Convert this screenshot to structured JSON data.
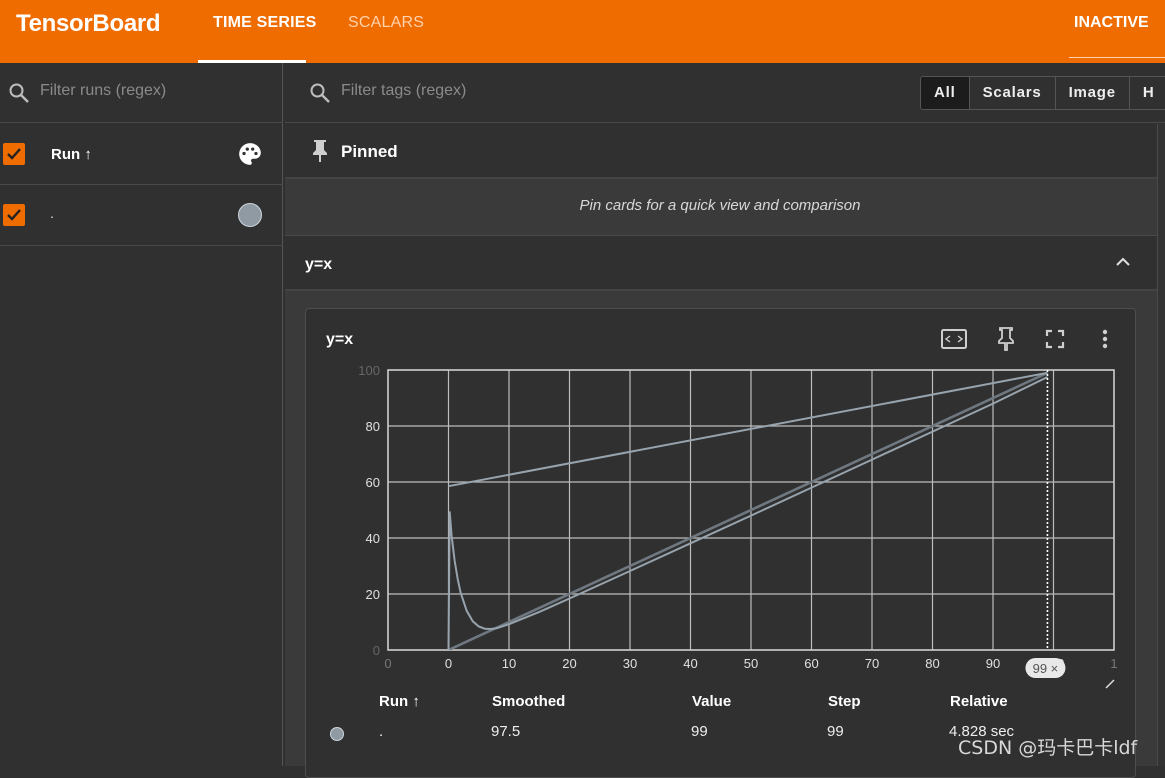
{
  "app": {
    "title": "TensorBoard"
  },
  "nav": {
    "tabs": [
      {
        "label": "TIME SERIES",
        "active": true
      },
      {
        "label": "SCALARS",
        "active": false
      }
    ],
    "reload_status": "INACTIVE"
  },
  "sidebar": {
    "filter_placeholder": "Filter runs (regex)",
    "header": {
      "label": "Run ↑",
      "checked": true
    },
    "runs": [
      {
        "name": ".",
        "checked": true,
        "color": "#8f9aa3"
      }
    ]
  },
  "main": {
    "filter_placeholder": "Filter tags (regex)",
    "type_filters": [
      {
        "label": "All",
        "active": true
      },
      {
        "label": "Scalars",
        "active": false
      },
      {
        "label": "Image",
        "active": false
      },
      {
        "label": "H",
        "active": false
      }
    ],
    "pinned": {
      "title": "Pinned",
      "empty_text": "Pin cards for a quick view and comparison"
    },
    "group": {
      "title": "y=x"
    },
    "card": {
      "title": "y=x",
      "icons": [
        "fit-domain-icon",
        "pin-icon",
        "fullscreen-icon",
        "more-vert-icon"
      ],
      "cursor_step_label": "99 ×"
    },
    "table": {
      "headers": {
        "run": "Run ↑",
        "smoothed": "Smoothed",
        "value": "Value",
        "step": "Step",
        "relative": "Relative"
      },
      "row": {
        "run": ".",
        "smoothed": "97.5",
        "value": "99",
        "step": "99",
        "relative": "4.828 sec"
      }
    }
  },
  "watermark": "CSDN @玛卡巴卡ldf",
  "chart_data": {
    "type": "line",
    "title": "y=x",
    "xlabel": "",
    "ylabel": "",
    "xlim": [
      -10,
      110
    ],
    "ylim": [
      0,
      100
    ],
    "x_ticks": [
      -10,
      0,
      10,
      20,
      30,
      40,
      50,
      60,
      70,
      80,
      90,
      100,
      110
    ],
    "x_tick_labels": [
      "0",
      "0",
      "10",
      "20",
      "30",
      "40",
      "50",
      "60",
      "70",
      "80",
      "90",
      "100",
      "1"
    ],
    "y_ticks": [
      0,
      20,
      40,
      60,
      80,
      100
    ],
    "y_tick_labels": [
      "0",
      "20",
      "40",
      "60",
      "80",
      "100"
    ],
    "grid": true,
    "cursor_step": 99,
    "series": [
      {
        "x": [
          0,
          99
        ],
        "y": [
          0,
          99
        ]
      },
      {
        "x": [
          0,
          0.2,
          0.5,
          1,
          1.5,
          2,
          3,
          4,
          5,
          6,
          7,
          8,
          10,
          15,
          20,
          30,
          40,
          50,
          60,
          70,
          80,
          90,
          99
        ],
        "y": [
          0,
          49.5,
          41.2,
          32.0,
          25.5,
          20.5,
          14.0,
          10.3,
          8.4,
          7.6,
          7.5,
          7.8,
          9.2,
          13.6,
          18.4,
          28.2,
          38.1,
          48.0,
          58.0,
          68.0,
          78.0,
          88.0,
          97.5
        ]
      }
    ],
    "connector": {
      "x": [
        0,
        99
      ],
      "y": [
        58.5,
        99
      ]
    }
  }
}
